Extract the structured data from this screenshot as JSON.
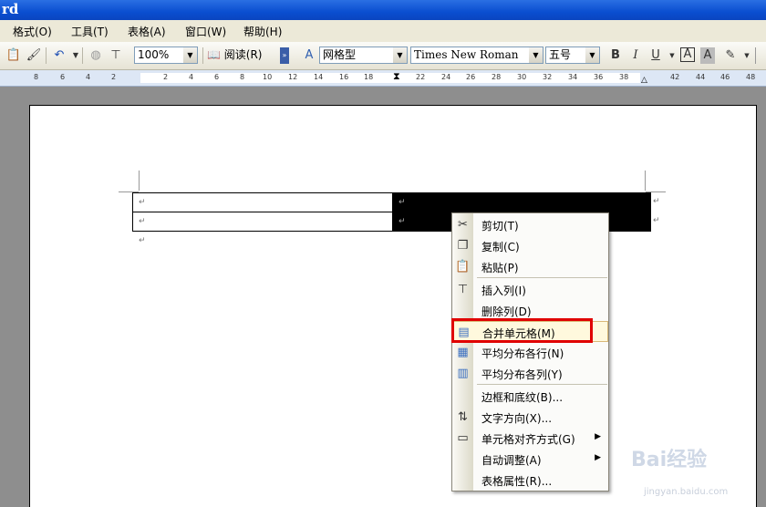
{
  "window": {
    "title": "rd"
  },
  "menu": [
    "格式(O)",
    "工具(T)",
    "表格(A)",
    "窗口(W)",
    "帮助(H)"
  ],
  "toolbar": {
    "zoom": "100%",
    "read_button": "阅读(R)",
    "style": "网格型",
    "font": "Times New Roman",
    "size": "五号",
    "bold": "B",
    "italic": "I",
    "underline": "U",
    "font_color": "A",
    "char_shading": "A"
  },
  "ruler": {
    "left_ticks": [
      "8",
      "6",
      "4",
      "2"
    ],
    "right_ticks": [
      "2",
      "4",
      "6",
      "8",
      "10",
      "12",
      "14",
      "16",
      "18",
      "22",
      "24",
      "26",
      "28",
      "30",
      "32",
      "34",
      "36",
      "38",
      "42",
      "44",
      "46",
      "48"
    ]
  },
  "document": {
    "paragraph_mark": "↵"
  },
  "context_menu": {
    "items": [
      {
        "label": "剪切(T)",
        "icon": "scissors-icon"
      },
      {
        "label": "复制(C)",
        "icon": "copy-icon"
      },
      {
        "label": "粘贴(P)",
        "icon": "paste-icon"
      },
      {
        "label": "插入列(I)",
        "icon": "insert-column-icon"
      },
      {
        "label": "删除列(D)",
        "icon": ""
      },
      {
        "label": "合并单元格(M)",
        "icon": "merge-cells-icon"
      },
      {
        "label": "平均分布各行(N)",
        "icon": "distribute-rows-icon"
      },
      {
        "label": "平均分布各列(Y)",
        "icon": "distribute-columns-icon"
      },
      {
        "label": "边框和底纹(B)...",
        "icon": ""
      },
      {
        "label": "文字方向(X)...",
        "icon": "text-direction-icon"
      },
      {
        "label": "单元格对齐方式(G)",
        "icon": "cell-alignment-icon"
      },
      {
        "label": "自动调整(A)",
        "icon": ""
      },
      {
        "label": "表格属性(R)...",
        "icon": ""
      }
    ]
  },
  "watermark": {
    "brand": "Bai经验",
    "url": "jingyan.baidu.com"
  }
}
